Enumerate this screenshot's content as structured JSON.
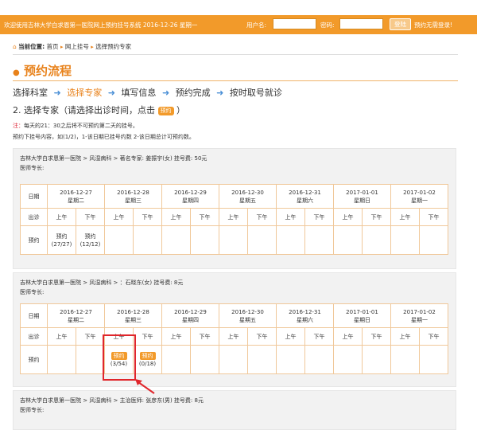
{
  "topbar": {
    "welcome": "欢迎使用吉林大学白求恩第一医院网上预约挂号系统  2016-12-26  星期一",
    "username_label": "用户名:",
    "password_label": "密码:",
    "login_label": "登陆",
    "noreg_label": "预约无需登录!"
  },
  "breadcrumb": {
    "prefix": "当前位置:",
    "items": [
      "首页",
      "网上挂号",
      "选择预约专家"
    ]
  },
  "section_title": "预约流程",
  "steps": [
    "选择科室",
    "选择专家",
    "填写信息",
    "预约完成",
    "按时取号就诊"
  ],
  "step_heading_before": "2. 选择专家（请选择出诊时间，点击",
  "step_heading_button": "预约",
  "step_heading_after": "）",
  "notes": {
    "note1_prefix": "注：",
    "note1_text": "每天的21：30之后将不可预约第二天的挂号。",
    "note2": "预约下挂号内容，如(1/2)，1-该日期已挂号约数 2-该日期总计可预约数。"
  },
  "date_header": "日期",
  "session_header": "出诊",
  "reserve_header": "预约",
  "am": "上午",
  "pm": "下午",
  "dates": [
    {
      "date": "2016-12-27",
      "weekday": "星期二"
    },
    {
      "date": "2016-12-28",
      "weekday": "星期三"
    },
    {
      "date": "2016-12-29",
      "weekday": "星期四"
    },
    {
      "date": "2016-12-30",
      "weekday": "星期五"
    },
    {
      "date": "2016-12-31",
      "weekday": "星期六"
    },
    {
      "date": "2017-01-01",
      "weekday": "星期日"
    },
    {
      "date": "2017-01-02",
      "weekday": "星期一"
    }
  ],
  "doctors": [
    {
      "line1": "吉林大学白求恩第一医院 > 风湿病科 > 著名专家: 姜振宇(女) 挂号费: 50元",
      "line2": "医师专长:",
      "slots": [
        {
          "label": "预约",
          "count": "(27/27)",
          "style": "plain"
        },
        {
          "label": "预约",
          "count": "(12/12)",
          "style": "plain"
        },
        null,
        null,
        null,
        null,
        null,
        null,
        null,
        null,
        null,
        null,
        null,
        null
      ]
    },
    {
      "line1": "吉林大学白求恩第一医院 > 风湿病科 > ：石晓东(女) 挂号费: 8元",
      "line2": "医师专长:",
      "slots": [
        null,
        null,
        {
          "label": "预约",
          "count": "(3/54)",
          "style": "tag"
        },
        {
          "label": "预约",
          "count": "(0/18)",
          "style": "tag"
        },
        null,
        null,
        null,
        null,
        null,
        null,
        null,
        null,
        null,
        null
      ]
    },
    {
      "line1": "吉林大学白求恩第一医院 > 风湿病科 > 主治医师: 张彦东(男) 挂号费: 8元",
      "line2": "医师专长:"
    }
  ],
  "colors": {
    "accent": "#f29a2a",
    "title": "#e8821b",
    "highlight": "#e0262b",
    "step_arrow": "#4a8fd6"
  }
}
